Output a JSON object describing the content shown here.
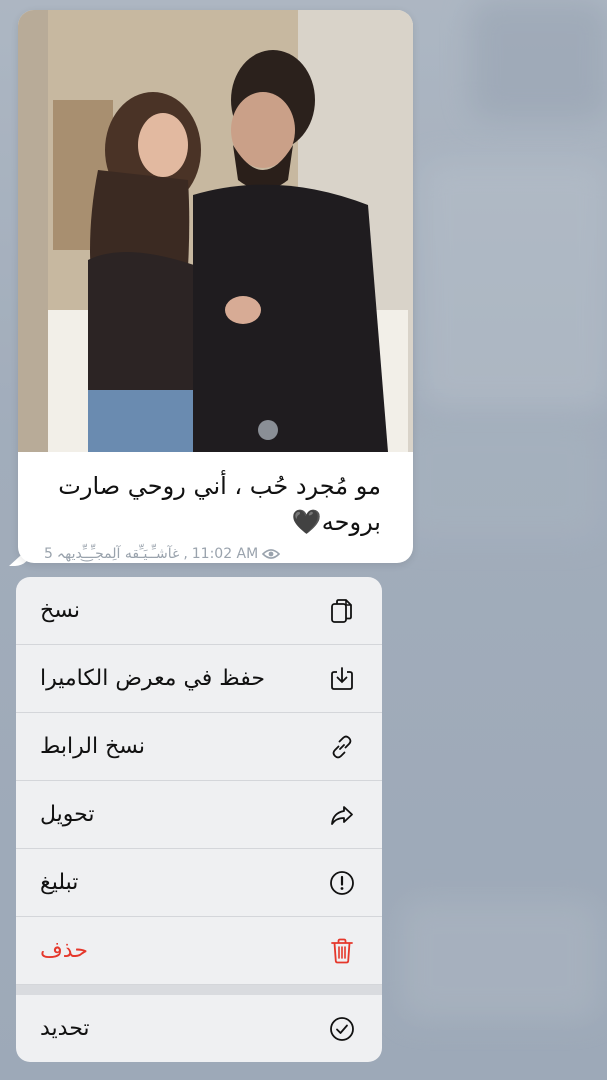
{
  "message": {
    "caption": "مو مُجرد حُب ، أني روحي صارت بروحه🖤",
    "views": "5",
    "author": "غآشـِّـيَـِّقه آلِمجـِّـ͜ـِّديهہ",
    "time": "11:02 AM"
  },
  "menu": {
    "items": [
      {
        "label": "نسخ",
        "icon": "copy-icon"
      },
      {
        "label": "حفظ في معرض الكاميرا",
        "icon": "save-download-icon"
      },
      {
        "label": "نسخ الرابط",
        "icon": "link-icon"
      },
      {
        "label": "تحويل",
        "icon": "forward-icon"
      },
      {
        "label": "تبليغ",
        "icon": "report-icon"
      },
      {
        "label": "حذف",
        "icon": "trash-icon",
        "color": "#e5372b"
      }
    ],
    "select": {
      "label": "تحديد",
      "icon": "checkmark-circle-icon"
    }
  },
  "colors": {
    "danger": "#e5372b",
    "menu_bg": "#eff0f2"
  }
}
